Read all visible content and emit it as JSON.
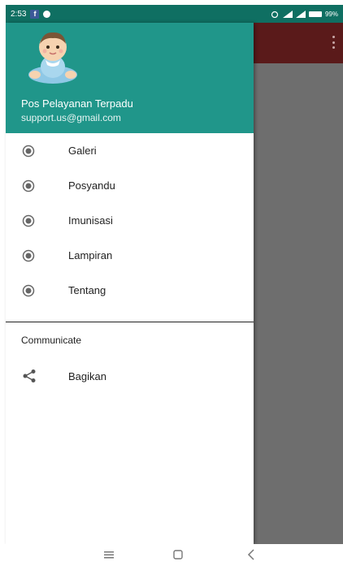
{
  "status_bar": {
    "time": "2:53",
    "facebook_glyph": "f",
    "battery": "99%"
  },
  "drawer": {
    "header": {
      "name": "Pos Pelayanan Terpadu",
      "email": "support.us@gmail.com",
      "avatar_icon": "baby-avatar-icon"
    },
    "menu_items": [
      {
        "label": "Galeri",
        "icon": "radio-icon"
      },
      {
        "label": "Posyandu",
        "icon": "radio-icon"
      },
      {
        "label": "Imunisasi",
        "icon": "radio-icon"
      },
      {
        "label": "Lampiran",
        "icon": "radio-icon"
      },
      {
        "label": "Tentang",
        "icon": "radio-icon"
      }
    ],
    "section_title": "Communicate",
    "share": {
      "label": "Bagikan",
      "icon": "share-icon"
    }
  },
  "colors": {
    "header": "#20968a",
    "status_bar": "#0f6f62",
    "toolbar_behind": "#5a1a1a",
    "scrim": "#6e6e6e"
  }
}
